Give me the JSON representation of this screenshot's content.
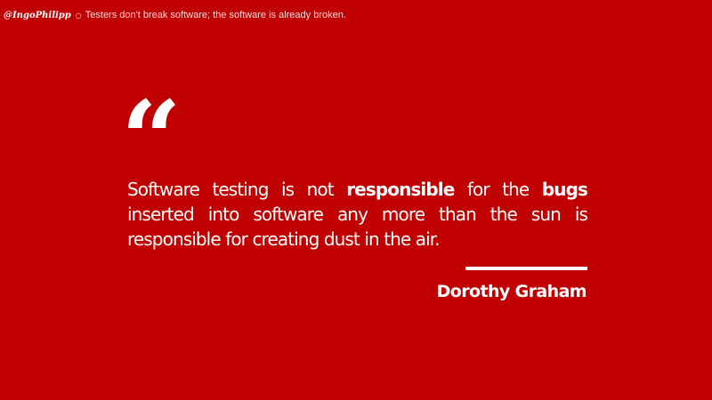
{
  "header": {
    "handle": "@IngoPhilipp",
    "separator": "○",
    "tagline": "Testers don't break software; the software is already broken."
  },
  "quote": {
    "mark": "“",
    "segments": [
      {
        "text": "Software testing is not ",
        "bold": false
      },
      {
        "text": "responsible",
        "bold": true
      },
      {
        "text": " for the ",
        "bold": false
      },
      {
        "text": "bugs",
        "bold": true
      },
      {
        "text": " inserted into software any more than the sun is responsible for creating dust in the air.",
        "bold": false
      }
    ],
    "author": "Dorothy Graham"
  },
  "colors": {
    "background": "#c00000",
    "text": "#ffffff"
  }
}
